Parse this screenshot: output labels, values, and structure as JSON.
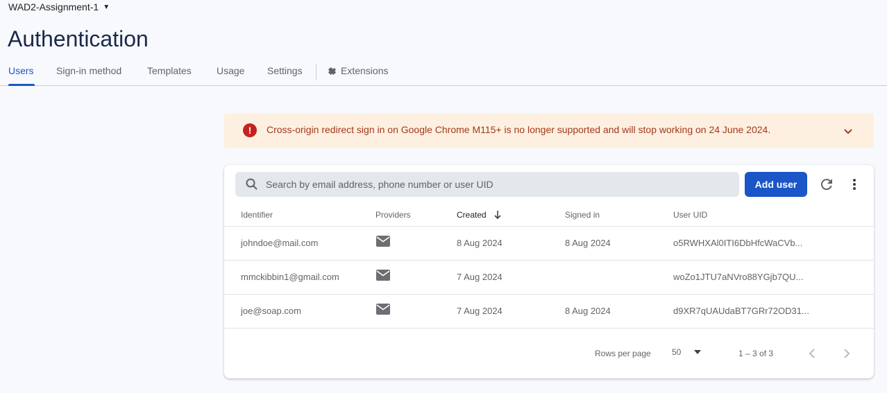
{
  "project": {
    "name": "WAD2-Assignment-1"
  },
  "page": {
    "title": "Authentication"
  },
  "tabs": [
    {
      "label": "Users"
    },
    {
      "label": "Sign-in method"
    },
    {
      "label": "Templates"
    },
    {
      "label": "Usage"
    },
    {
      "label": "Settings"
    },
    {
      "label": "Extensions"
    }
  ],
  "banner": {
    "message": "Cross-origin redirect sign in on Google Chrome M115+ is no longer supported and will stop working on 24 June 2024.",
    "icon": "error-icon",
    "color": "#a4371d",
    "background": "#fdf0e0"
  },
  "search": {
    "placeholder": "Search by email address, phone number or user UID"
  },
  "toolbar": {
    "add_user_label": "Add user",
    "refresh_icon": "refresh-icon",
    "more_icon": "more-vert-icon"
  },
  "table": {
    "headers": {
      "identifier": "Identifier",
      "providers": "Providers",
      "created": "Created",
      "signed_in": "Signed in",
      "uid": "User UID"
    },
    "rows": [
      {
        "identifier": "johndoe@mail.com",
        "provider": "email-icon",
        "created": "8 Aug 2024",
        "signed_in": "8 Aug 2024",
        "uid": "o5RWHXAl0ITI6DbHfcWaCVb..."
      },
      {
        "identifier": "mmckibbin1@gmail.com",
        "provider": "email-icon",
        "created": "7 Aug 2024",
        "signed_in": "",
        "uid": "woZo1JTU7aNVro88YGjb7QU..."
      },
      {
        "identifier": "joe@soap.com",
        "provider": "email-icon",
        "created": "7 Aug 2024",
        "signed_in": "8 Aug 2024",
        "uid": "d9XR7qUAUdaBT7GRr72OD31..."
      }
    ]
  },
  "pagination": {
    "rows_per_page_label": "Rows per page",
    "rows_per_page_value": "50",
    "range": "1 – 3 of 3"
  },
  "colors": {
    "accent": "#1a56c7",
    "title": "#1b2a4a",
    "error": "#c5221f"
  }
}
